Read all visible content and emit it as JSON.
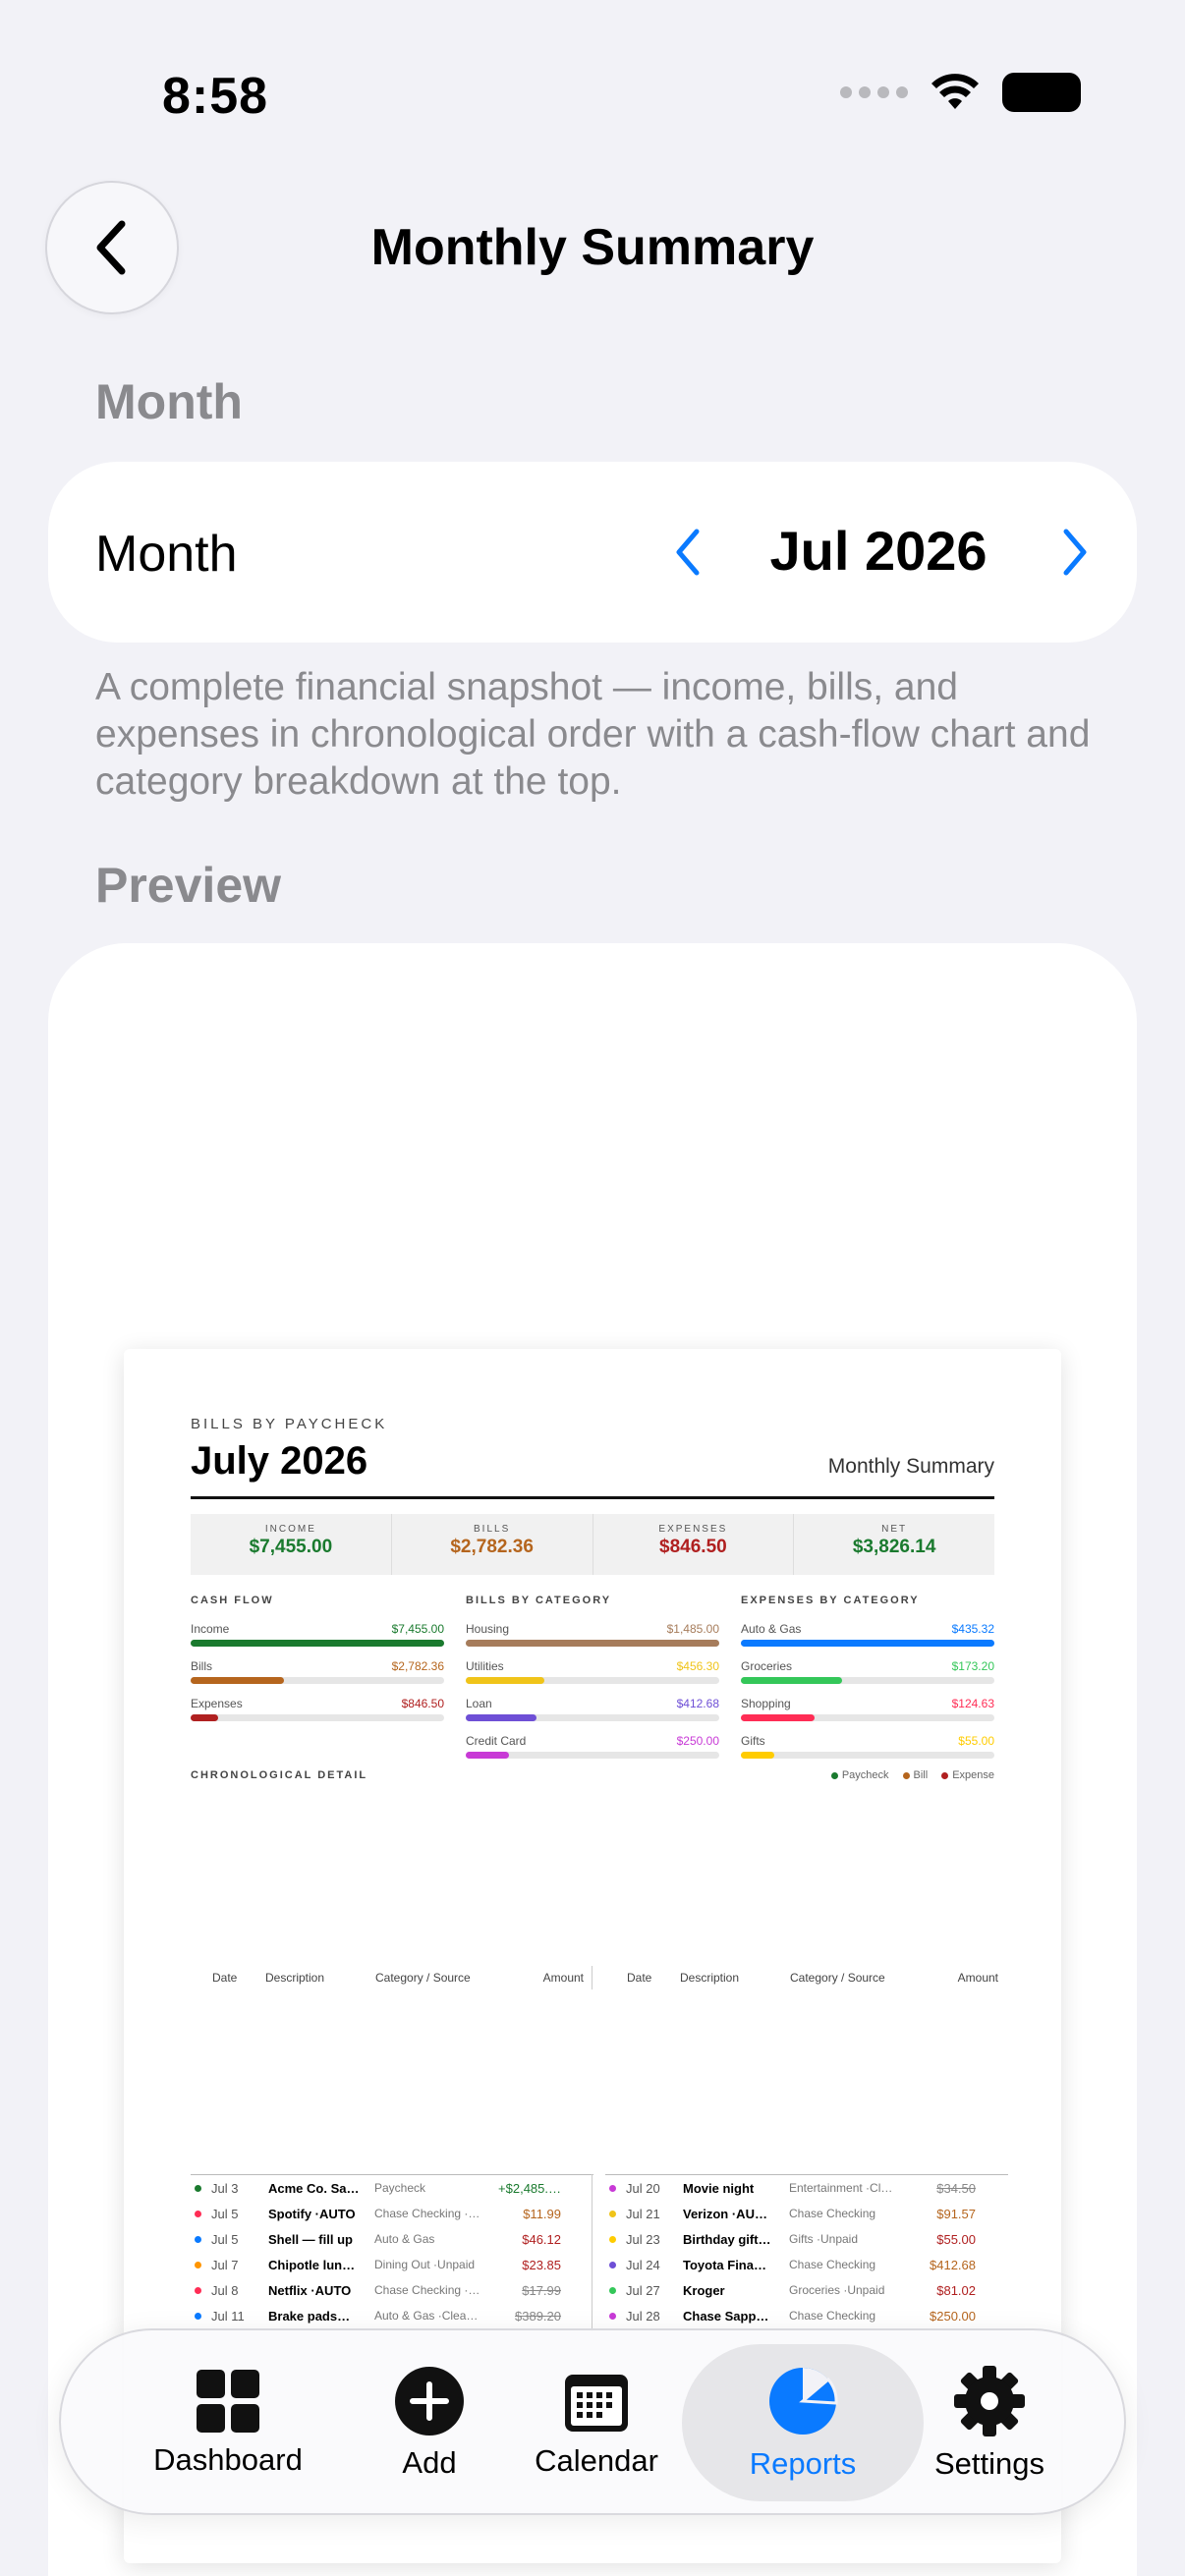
{
  "status_bar": {
    "time": "8:58"
  },
  "nav": {
    "title": "Monthly Summary"
  },
  "month_section": {
    "header": "Month",
    "row_label": "Month",
    "value": "Jul 2026"
  },
  "description": "A complete financial snapshot — income, bills, and expenses in chronological order with a cash-flow chart and category breakdown at the top.",
  "preview_section": {
    "header": "Preview"
  },
  "report": {
    "kicker": "BILLS BY PAYCHECK",
    "title": "July 2026",
    "subtitle": "Monthly Summary",
    "stats": [
      {
        "label": "INCOME",
        "value": "$7,455.00",
        "color": "#1a7a2e"
      },
      {
        "label": "BILLS",
        "value": "$2,782.36",
        "color": "#b5651d"
      },
      {
        "label": "EXPENSES",
        "value": "$846.50",
        "color": "#b02020"
      },
      {
        "label": "NET",
        "value": "$3,826.14",
        "color": "#1a7a2e"
      }
    ],
    "cash_flow": {
      "title": "CASH FLOW",
      "items": [
        {
          "label": "Income",
          "value": "$7,455.00",
          "fraction": 1.0,
          "color": "#1a7a2e"
        },
        {
          "label": "Bills",
          "value": "$2,782.36",
          "fraction": 0.37,
          "color": "#b5651d"
        },
        {
          "label": "Expenses",
          "value": "$846.50",
          "fraction": 0.11,
          "color": "#b02020"
        }
      ]
    },
    "bills_by_category": {
      "title": "BILLS BY CATEGORY",
      "items": [
        {
          "label": "Housing",
          "value": "$1,485.00",
          "fraction": 1.0,
          "color": "#a67c5b"
        },
        {
          "label": "Utilities",
          "value": "$456.30",
          "fraction": 0.31,
          "color": "#f0c419"
        },
        {
          "label": "Loan",
          "value": "$412.68",
          "fraction": 0.28,
          "color": "#6e4fd6"
        },
        {
          "label": "Credit Card",
          "value": "$250.00",
          "fraction": 0.17,
          "color": "#c83ad6"
        }
      ]
    },
    "expenses_by_category": {
      "title": "EXPENSES BY CATEGORY",
      "items": [
        {
          "label": "Auto & Gas",
          "value": "$435.32",
          "fraction": 1.0,
          "color": "#0a7aff"
        },
        {
          "label": "Groceries",
          "value": "$173.20",
          "fraction": 0.4,
          "color": "#34c759"
        },
        {
          "label": "Shopping",
          "value": "$124.63",
          "fraction": 0.29,
          "color": "#ff2d55"
        },
        {
          "label": "Gifts",
          "value": "$55.00",
          "fraction": 0.13,
          "color": "#ffcc00"
        }
      ]
    },
    "chrono_title": "CHRONOLOGICAL DETAIL",
    "legend": [
      {
        "label": "Paycheck",
        "color": "#1a7a2e"
      },
      {
        "label": "Bill",
        "color": "#b5651d"
      },
      {
        "label": "Expense",
        "color": "#b02020"
      }
    ],
    "table_headers": [
      "Date",
      "Description",
      "Category / Source",
      "Amount"
    ],
    "rows_left": [
      {
        "date": "Jul 3",
        "desc": "Acme Co. Sa…",
        "cat": "Paycheck",
        "amt": "+$2,485.…",
        "dot": "#1a7a2e",
        "amt_color": "#1a7a2e",
        "strike": false
      },
      {
        "date": "Jul 5",
        "desc": "Spotify ·AUTO",
        "cat": "Chase Checking ·…",
        "amt": "$11.99",
        "dot": "#ff2d55",
        "amt_color": "#b5651d",
        "strike": false
      },
      {
        "date": "Jul 5",
        "desc": "Shell — fill up",
        "cat": "Auto & Gas",
        "amt": "$46.12",
        "dot": "#0a7aff",
        "amt_color": "#b02020",
        "strike": false
      },
      {
        "date": "Jul 7",
        "desc": "Chipotle lun…",
        "cat": "Dining Out ·Unpaid",
        "amt": "$23.85",
        "dot": "#ff9500",
        "amt_color": "#b02020",
        "strike": false
      },
      {
        "date": "Jul 8",
        "desc": "Netflix ·AUTO",
        "cat": "Chase Checking ·…",
        "amt": "$17.99",
        "dot": "#ff2d55",
        "amt_color": "#888888",
        "strike": true
      },
      {
        "date": "Jul 11",
        "desc": "Brake pads…",
        "cat": "Auto & Gas ·Clea…",
        "amt": "$389.20",
        "dot": "#0a7aff",
        "amt_color": "#888888",
        "strike": true
      }
    ],
    "rows_right": [
      {
        "date": "Jul 20",
        "desc": "Movie night",
        "cat": "Entertainment ·Cl…",
        "amt": "$34.50",
        "dot": "#c83ad6",
        "amt_color": "#888888",
        "strike": true
      },
      {
        "date": "Jul 21",
        "desc": "Verizon ·AU…",
        "cat": "Chase Checking",
        "amt": "$91.57",
        "dot": "#f0c419",
        "amt_color": "#b5651d",
        "strike": false
      },
      {
        "date": "Jul 23",
        "desc": "Birthday gift…",
        "cat": "Gifts ·Unpaid",
        "amt": "$55.00",
        "dot": "#ffcc00",
        "amt_color": "#b02020",
        "strike": false
      },
      {
        "date": "Jul 24",
        "desc": "Toyota Fina…",
        "cat": "Chase Checking",
        "amt": "$412.68",
        "dot": "#6e4fd6",
        "amt_color": "#b5651d",
        "strike": false
      },
      {
        "date": "Jul 27",
        "desc": "Kroger",
        "cat": "Groceries ·Unpaid",
        "amt": "$81.02",
        "dot": "#34c759",
        "amt_color": "#b02020",
        "strike": false
      },
      {
        "date": "Jul 28",
        "desc": "Chase Sapp…",
        "cat": "Chase Checking",
        "amt": "$250.00",
        "dot": "#c83ad6",
        "amt_color": "#b5651d",
        "strike": false
      }
    ]
  },
  "tab_bar": {
    "tabs": [
      {
        "label": "Dashboard",
        "icon": "grid-icon",
        "active": false
      },
      {
        "label": "Add",
        "icon": "plus-circle-icon",
        "active": false
      },
      {
        "label": "Calendar",
        "icon": "calendar-icon",
        "active": false
      },
      {
        "label": "Reports",
        "icon": "pie-chart-icon",
        "active": true
      },
      {
        "label": "Settings",
        "icon": "gear-icon",
        "active": false
      }
    ],
    "active_color": "#0a7aff"
  }
}
